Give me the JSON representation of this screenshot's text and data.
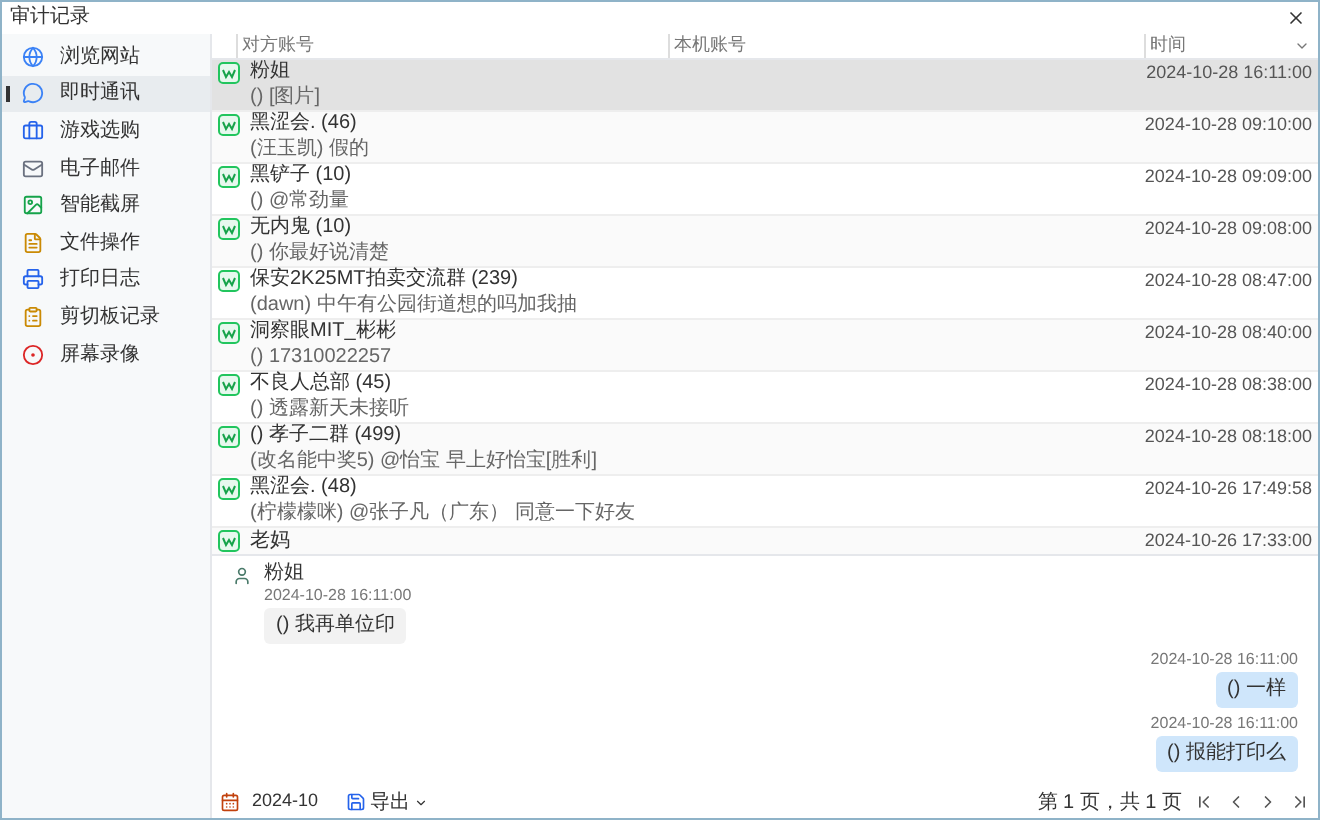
{
  "window": {
    "title": "审计记录"
  },
  "sidebar": {
    "items": [
      {
        "label": "浏览网站",
        "kind": "globe",
        "selected": false
      },
      {
        "label": "即时通讯",
        "kind": "chat",
        "selected": true
      },
      {
        "label": "游戏选购",
        "kind": "briefcase",
        "selected": false
      },
      {
        "label": "电子邮件",
        "kind": "mail",
        "selected": false
      },
      {
        "label": "智能截屏",
        "kind": "image",
        "selected": false
      },
      {
        "label": "文件操作",
        "kind": "file",
        "selected": false
      },
      {
        "label": "打印日志",
        "kind": "printer",
        "selected": false
      },
      {
        "label": "剪切板记录",
        "kind": "clipboard",
        "selected": false
      },
      {
        "label": "屏幕录像",
        "kind": "record",
        "selected": false
      }
    ]
  },
  "table": {
    "columns": [
      "对方账号",
      "本机账号",
      "时间"
    ],
    "rows": [
      {
        "name": "粉姐",
        "message": "() [图片]",
        "time": "2024-10-28 16:11:00",
        "selected": true
      },
      {
        "name": "黑涩会. (46)",
        "message": "(汪玉凯) 假的",
        "time": "2024-10-28 09:10:00",
        "selected": false
      },
      {
        "name": "黑铲子 (10)",
        "message": "() @常劲量",
        "time": "2024-10-28 09:09:00",
        "selected": false
      },
      {
        "name": "无内鬼 (10)",
        "message": "() 你最好说清楚",
        "time": "2024-10-28 09:08:00",
        "selected": false
      },
      {
        "name": "保安2K25MT拍卖交流群 (239)",
        "message": "(dawn) 中午有公园街道想的吗加我抽",
        "time": "2024-10-28 08:47:00",
        "selected": false
      },
      {
        "name": "洞察眼MIT_彬彬",
        "message": "() 17310022257",
        "time": "2024-10-28 08:40:00",
        "selected": false
      },
      {
        "name": "不良人总部 (45)",
        "message": "() 透露新天未接听",
        "time": "2024-10-28 08:38:00",
        "selected": false
      },
      {
        "name": "() 孝子二群 (499)",
        "message": "(改名能中奖5) @怡宝 早上好怡宝[胜利]",
        "time": "2024-10-28 08:18:00",
        "selected": false
      },
      {
        "name": "黑涩会. (48)",
        "message": "(柠檬檬咪) @张子凡（广东） 同意一下好友",
        "time": "2024-10-26 17:49:58",
        "selected": false
      },
      {
        "name": "老妈",
        "time": "2024-10-26 17:33:00",
        "selected": false
      }
    ]
  },
  "chat": {
    "messages": [
      {
        "kind": "received",
        "sender": "粉姐",
        "time": "2024-10-28 16:11:00",
        "text": "() 我再单位印"
      },
      {
        "kind": "sent",
        "time": "2024-10-28 16:11:00",
        "text": "() 一样"
      },
      {
        "kind": "sent",
        "time": "2024-10-28 16:11:00",
        "text": "() 报能打印么"
      }
    ]
  },
  "footer": {
    "month": "2024-10",
    "export": "导出",
    "page_info": "第 1 页，共 1 页"
  }
}
